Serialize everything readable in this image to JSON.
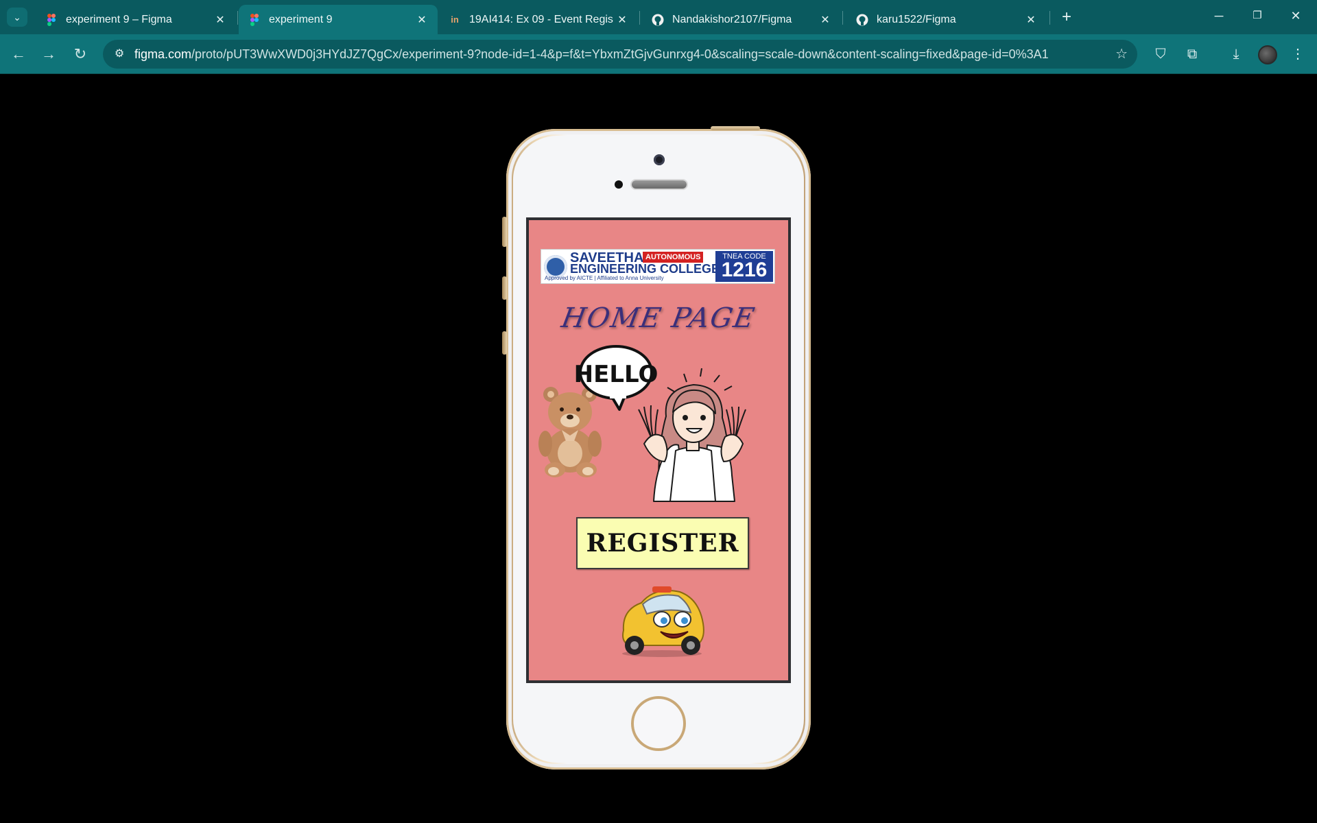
{
  "browser": {
    "tabs": [
      {
        "title": "experiment 9 – Figma",
        "icon": "figma-icon",
        "active": false
      },
      {
        "title": "experiment 9",
        "icon": "figma-icon",
        "active": true
      },
      {
        "title": "19AI414: Ex 09 - Event Registrat",
        "icon": "invision-icon",
        "active": false
      },
      {
        "title": "Nandakishor2107/Figma",
        "icon": "github-icon",
        "active": false
      },
      {
        "title": "karu1522/Figma",
        "icon": "github-icon",
        "active": false
      }
    ],
    "url_host": "figma.com",
    "url_path": "/proto/pUT3WwXWD0j3HYdJZ7QgCx/experiment-9?node-id=1-4&p=f&t=YbxmZtGjvGunrxg4-0&scaling=scale-down&content-scaling=fixed&page-id=0%3A1",
    "colors": {
      "tabbar": "#0a5a5f",
      "toolbar": "#0f7479"
    }
  },
  "app": {
    "logo": {
      "name_line1": "SAVEETHA",
      "name_line2": "ENGINEERING COLLEGE",
      "badge": "AUTONOMOUS",
      "subtitle": "Approved by AICTE | Affiliated to Anna University",
      "code_label": "TNEA CODE",
      "code_value": "1216"
    },
    "title": "HOME PAGE",
    "speech_bubble": "HELLO",
    "register_label": "REGISTER",
    "colors": {
      "screen_bg": "#e88686",
      "button_bg": "#fafdb2",
      "title": "#3b2f7a"
    }
  }
}
